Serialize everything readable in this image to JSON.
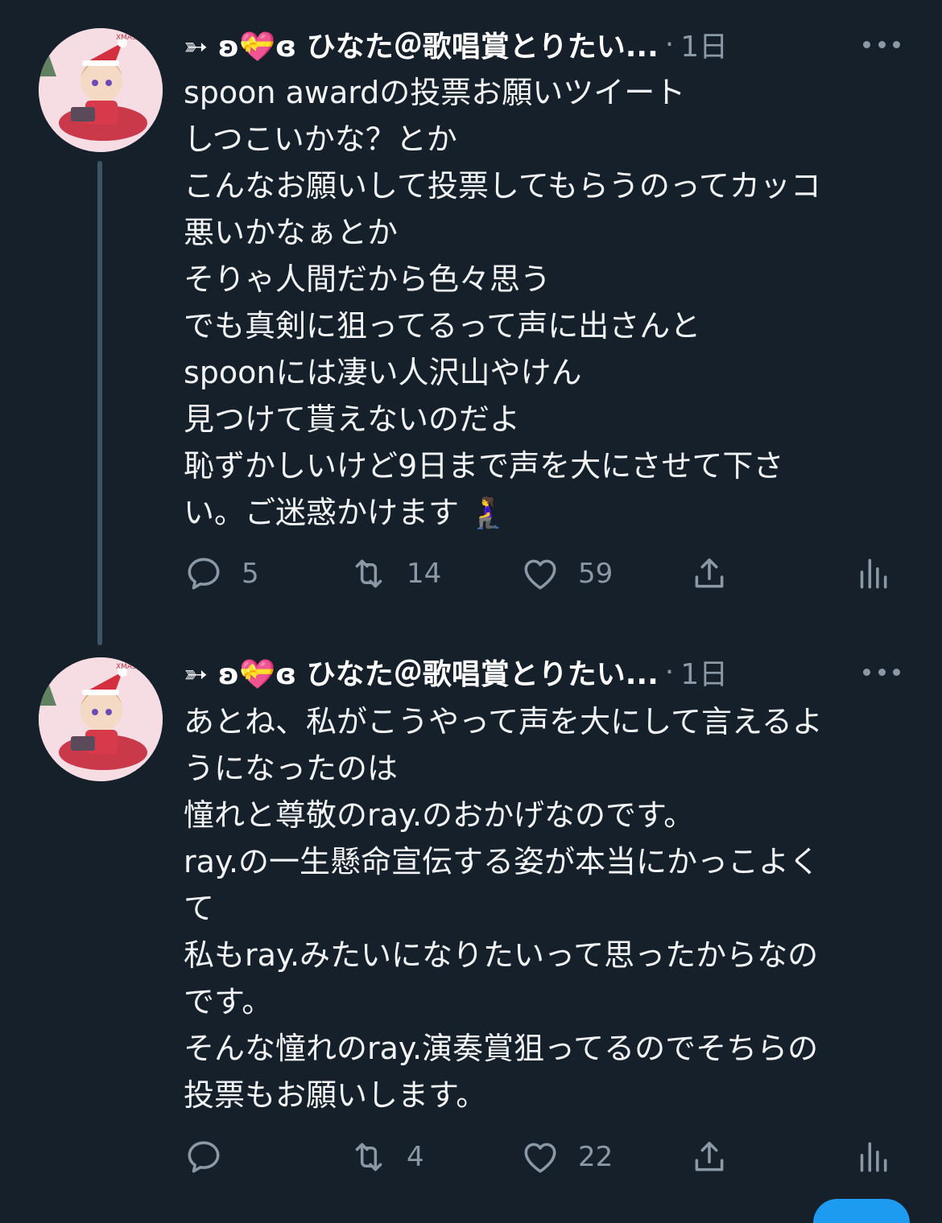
{
  "tweets": [
    {
      "author": {
        "name": "➳ ʚ💝ɞ ひなた＠歌唱賞とりたい...",
        "avatar_label": "XMAS"
      },
      "separator": "·",
      "time": "1日",
      "lines": [
        "spoon awardの投票お願いツイート",
        "しつこいかな？とか",
        "こんなお願いして投票してもらうのってカッコ",
        "悪いかなぁとか",
        "そりゃ人間だから色々思う",
        "でも真剣に狙ってるって声に出さんと",
        "spoonには凄い人沢山やけん",
        "見つけて貰えないのだよ",
        "恥ずかしいけど9日まで声を大にさせて下さ",
        "い。ご迷惑かけます 🧎‍♀️"
      ],
      "stats": {
        "replies": "5",
        "retweets": "14",
        "likes": "59"
      }
    },
    {
      "author": {
        "name": "➳ ʚ💝ɞ ひなた＠歌唱賞とりたい...",
        "avatar_label": "XMAS"
      },
      "separator": "·",
      "time": "1日",
      "lines": [
        "あとね、私がこうやって声を大にして言えるよ",
        "うになったのは",
        "憧れと尊敬のray.のおかげなのです。",
        "ray.の一生懸命宣伝する姿が本当にかっこよく",
        "て",
        "私もray.みたいになりたいって思ったからなの",
        "です。",
        "そんな憧れのray.演奏賞狙ってるのでそちらの",
        "投票もお願いします。"
      ],
      "stats": {
        "replies": "",
        "retweets": "4",
        "likes": "22"
      }
    }
  ],
  "icons": [
    "reply-icon",
    "retweet-icon",
    "like-icon",
    "share-icon",
    "analytics-icon",
    "more-icon"
  ],
  "colors": {
    "background": "#15202b",
    "text": "#f2f4f5",
    "muted": "#8b98a5",
    "thread_line": "#3d5466"
  }
}
